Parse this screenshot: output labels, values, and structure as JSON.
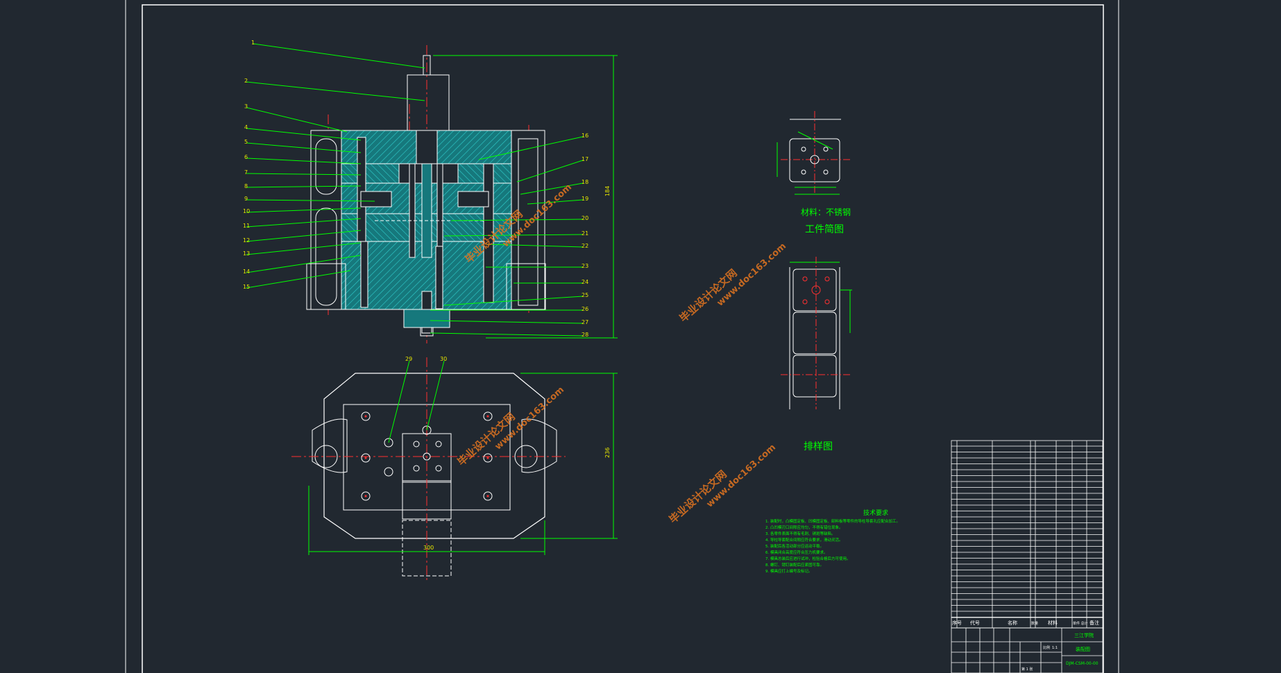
{
  "part_labels_left": [
    "1",
    "2",
    "3",
    "4",
    "5",
    "6",
    "7",
    "8",
    "9",
    "10",
    "11",
    "12",
    "13",
    "14",
    "15"
  ],
  "part_labels_right": [
    "16",
    "17",
    "18",
    "19",
    "20",
    "21",
    "22",
    "23",
    "24",
    "25",
    "26",
    "27",
    "28"
  ],
  "plan_labels": [
    "29",
    "30"
  ],
  "part_drawing": {
    "material": "材料：不锈钢",
    "title": "工件简图"
  },
  "layout_title": "排样图",
  "tech_req": {
    "title": "技术要求",
    "lines": [
      "1. 装配时，凸模固定板、凹模固定板、卸料板等零件的导柱导套孔应配合加工。",
      "2. 凸凹模刃口间隙应均匀，不得有错位现象。",
      "3. 各零件表面不得有毛刺、锈斑等缺陷。",
      "4. 导柱导套配合间隙应符合要求，滑动灵活。",
      "5. 装配后各活动部分应运动平稳。",
      "6. 模具闭合高度应符合压力机要求。",
      "7. 模具总装后应进行试冲，检验合格后方可使用。",
      "8. 螺钉、销钉装配后应紧固可靠。",
      "9. 模具应打上编号及标记。"
    ]
  },
  "title_block": {
    "school": "三江学院",
    "drawing_name": "装配图",
    "drawing_no": "DJM-CSM-00-00",
    "col_no": "序号",
    "col_code": "代号",
    "col_name": "名称",
    "col_qty": "数量",
    "col_material": "材料",
    "col_remark": "备注",
    "col_weight": "单件 总计",
    "scale_label": "比例",
    "scale": "1:1",
    "sheet": "第 1 张"
  },
  "watermark": {
    "brand": "毕业设计论文网",
    "url": "www.doc163.com"
  },
  "colors": {
    "background": "#212830",
    "outline": "#ffffff",
    "leader": "#00ff00",
    "centerline": "#ff3030",
    "hatch": "#1fa6a6",
    "label": "#e6e600",
    "watermark": "#e37520"
  }
}
